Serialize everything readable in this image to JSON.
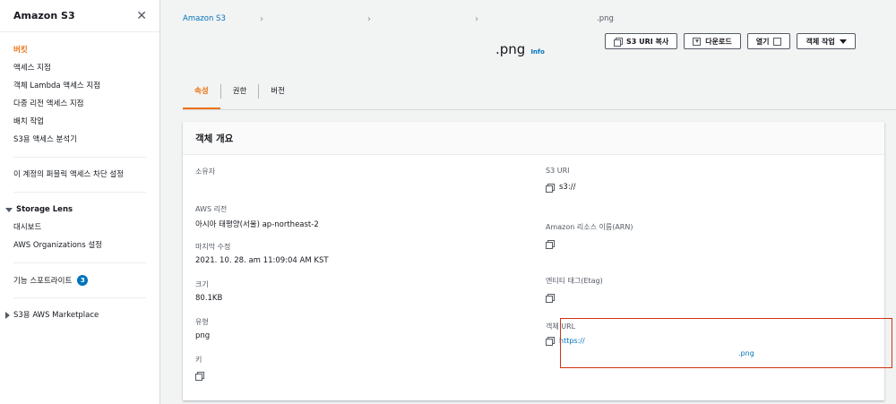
{
  "sidebar": {
    "title": "Amazon S3",
    "items": [
      {
        "label": "버킷",
        "active": true
      },
      {
        "label": "액세스 지점"
      },
      {
        "label": "객체 Lambda 액세스 지점"
      },
      {
        "label": "다중 리전 액세스 지점"
      },
      {
        "label": "배치 작업"
      },
      {
        "label": "S3용 액세스 분석기"
      }
    ],
    "block_public_access": "이 계정의 퍼블릭 액세스 차단 설정",
    "storage_lens": {
      "title": "Storage Lens",
      "items": [
        "대시보드",
        "AWS Organizations 설정"
      ]
    },
    "feature_spotlight": {
      "label": "기능 스포트라이트",
      "count": "3"
    },
    "marketplace": "S3용 AWS Marketplace"
  },
  "breadcrumb": {
    "root": "Amazon S3",
    "current": ".png"
  },
  "page": {
    "title": ".png",
    "info": "Info"
  },
  "actions": {
    "copy_uri": "S3 URI 복사",
    "download": "다운로드",
    "open": "열기",
    "object_actions": "객체 작업"
  },
  "tabs": [
    {
      "label": "속성",
      "active": true
    },
    {
      "label": "권한"
    },
    {
      "label": "버전"
    }
  ],
  "overview": {
    "title": "객체 개요",
    "owner_label": "소유자",
    "owner_value": "",
    "region_label": "AWS 리전",
    "region_value": "아시아 태평양(서울) ap-northeast-2",
    "modified_label": "마지막 수정",
    "modified_value": "2021. 10. 28. am 11:09:04 AM KST",
    "size_label": "크기",
    "size_value": "80.1KB",
    "type_label": "유형",
    "type_value": "png",
    "key_label": "키",
    "s3uri_label": "S3 URI",
    "s3uri_value": "s3://",
    "arn_label": "Amazon 리소스 이름(ARN)",
    "etag_label": "엔티티 태그(Etag)",
    "url_label": "객체 URL",
    "url_value_line1": "https://",
    "url_value_line2": ".png"
  },
  "colors": {
    "accent": "#ec7211",
    "link": "#0073bb",
    "highlight": "#d13212"
  }
}
